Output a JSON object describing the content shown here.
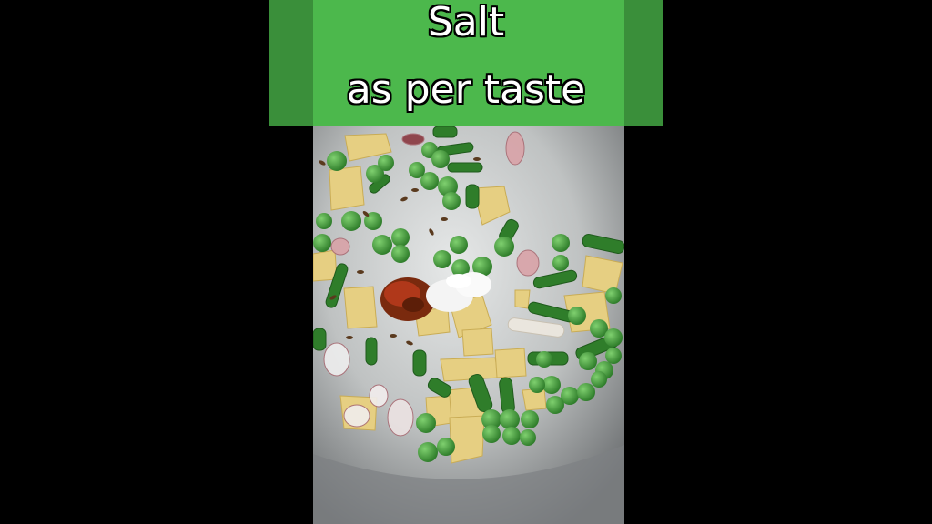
{
  "caption": {
    "line1": "Salt",
    "line2": "as per taste"
  },
  "colors": {
    "banner_outer": "#3a8f3a",
    "banner_inner": "#4cb84c",
    "pan": "#b9bcbc",
    "peas": "#3e9a3a",
    "beans": "#2f7d2a",
    "potato": "#e6cf82",
    "chili_powder": "#8a2a10",
    "salt": "#f4f4f4"
  },
  "scene": {
    "subject": "steel pan with peas, green beans, potato cubes, onion, cumin, red chili powder and salt"
  }
}
